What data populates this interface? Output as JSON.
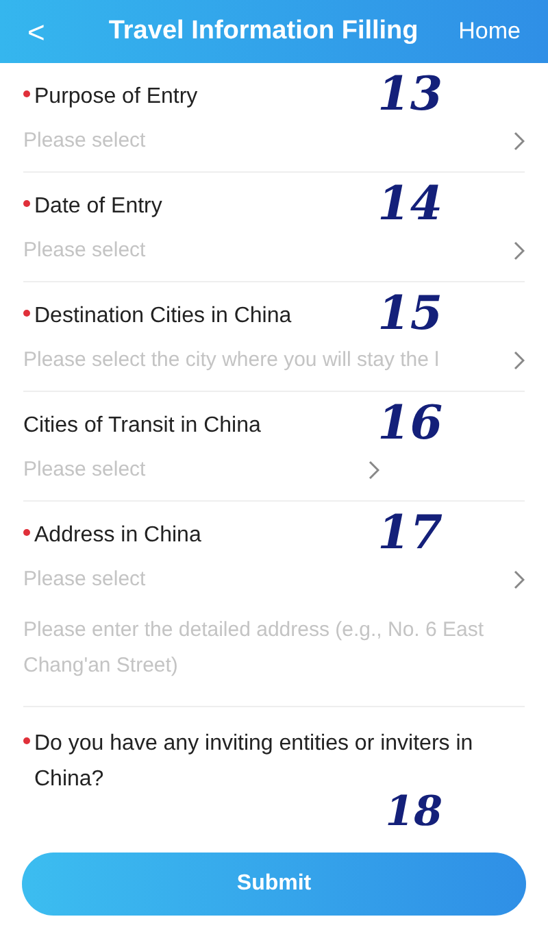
{
  "header": {
    "back": "<",
    "title": "Travel Information Filling",
    "home": "Home"
  },
  "fields": [
    {
      "kind": "select",
      "label": "Purpose of Entry",
      "required": true,
      "placeholder": "Please select",
      "annotation": "13"
    },
    {
      "kind": "select",
      "label": "Date of Entry",
      "required": true,
      "placeholder": "Please select",
      "annotation": "14"
    },
    {
      "kind": "select",
      "label": "Destination Cities in China",
      "required": true,
      "placeholder": "Please select the city where you will stay the l",
      "annotation": "15"
    },
    {
      "kind": "select",
      "label": "Cities of Transit in China",
      "required": false,
      "placeholder": "Please select",
      "annotation": "16"
    },
    {
      "kind": "address",
      "label": "Address in China",
      "required": true,
      "placeholder": "Please select",
      "detail_placeholder": "Please enter the detailed address (e.g., No. 6 East Chang'an Street)",
      "annotation": "17"
    },
    {
      "kind": "question",
      "label": "Do you have any inviting entities or inviters in China?",
      "required": true,
      "annotation": "18"
    }
  ],
  "submit": "Submit"
}
